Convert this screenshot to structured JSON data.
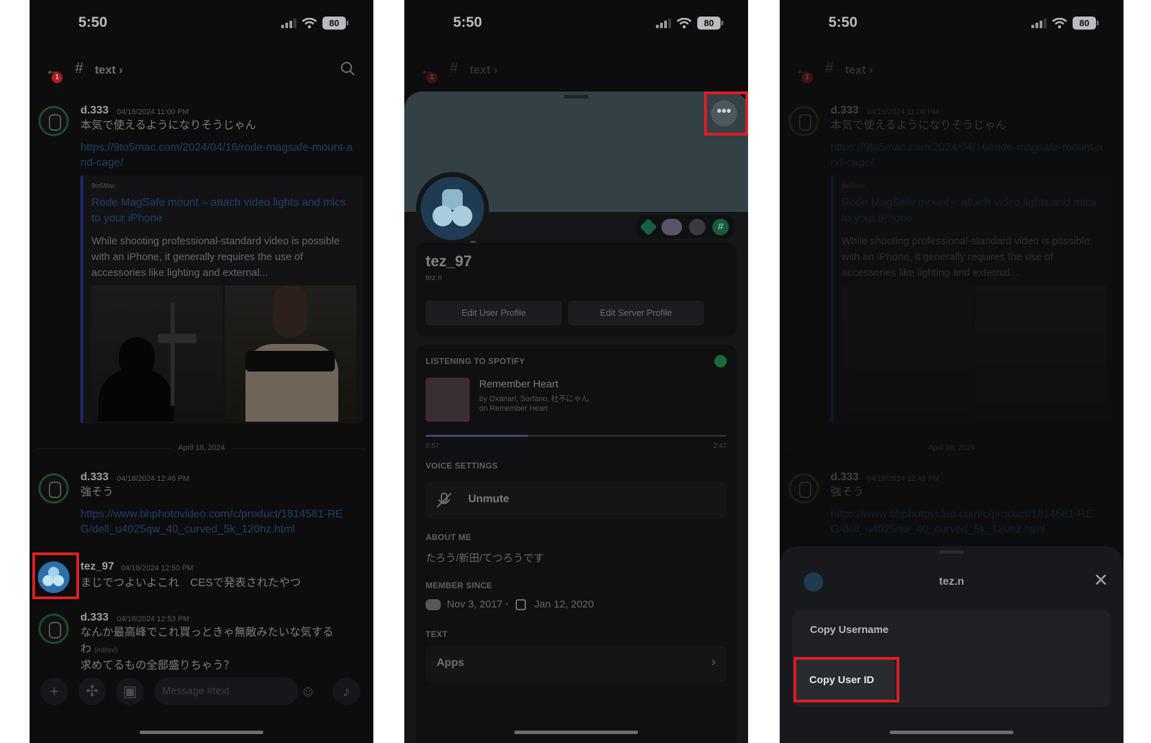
{
  "status": {
    "time": "5:50",
    "battery": "80"
  },
  "channel": {
    "name": "text",
    "chevron": "›",
    "unread": "1"
  },
  "chat": {
    "messages": [
      {
        "user": "d.333",
        "time": "04/16/2024 11:00 PM",
        "text": "本気で使えるようになりそうじゃん",
        "link": "https://9to5mac.com/2024/04/16/rode-magsafe-mount-and-cage/"
      },
      {
        "user": "d.333",
        "time": "04/18/2024 12:46 PM",
        "text": "強そう",
        "link": "https://www.bhphotovideo.com/c/product/1814581-REG/dell_u4025qw_40_curved_5k_120hz.html"
      },
      {
        "user": "tez_97",
        "time": "04/18/2024 12:50 PM",
        "text": "まじでつよいよこれ　CESで発表されたやつ"
      },
      {
        "user": "d.333",
        "time": "04/18/2024 12:53 PM",
        "text": "なんか最高峰でこれ買っときゃ無敵みたいな気する",
        "text2": "わ",
        "edited": "(edited)",
        "text3": "求めてるもの全部盛りちゃう？"
      }
    ],
    "embed": {
      "provider": "9to5Mac",
      "title": "Rode MagSafe mount – attach video lights and mics to your iPhone",
      "description": "While shooting professional-standard video is possible with an iPhone, it generally requires the use of accessories like lighting and external..."
    },
    "date_divider": "April 18, 2024",
    "input_placeholder": "Message #text"
  },
  "profile": {
    "display_name": "tez_97",
    "username": "tez.n",
    "more_icon": "•••",
    "edit_user_profile": "Edit User Profile",
    "edit_server_profile": "Edit Server Profile",
    "spotify": {
      "header": "LISTENING TO SPOTIFY",
      "song": "Remember Heart",
      "artists": "by Oxanar!, Sorfano, 社不にゃん",
      "album": "on Remember Heart",
      "elapsed": "0:57",
      "duration": "2:47",
      "progress": 0.34
    },
    "voice_header": "VOICE SETTINGS",
    "unmute_label": "Unmute",
    "about_header": "ABOUT ME",
    "about_text": "たろう/新田/てつろうです",
    "member_header": "MEMBER SINCE",
    "discord_since": "Nov 3, 2017",
    "server_since": "Jan 12, 2020",
    "text_header": "TEXT",
    "apps_label": "Apps",
    "apps_chevron": "›"
  },
  "action_sheet": {
    "title": "tez.n",
    "close": "✕",
    "items": [
      {
        "label": "Copy Username"
      },
      {
        "label": "Copy User ID"
      }
    ]
  },
  "colors": {
    "highlight": "#e01d24",
    "online": "#23a55a",
    "link": "#00a8fc"
  }
}
